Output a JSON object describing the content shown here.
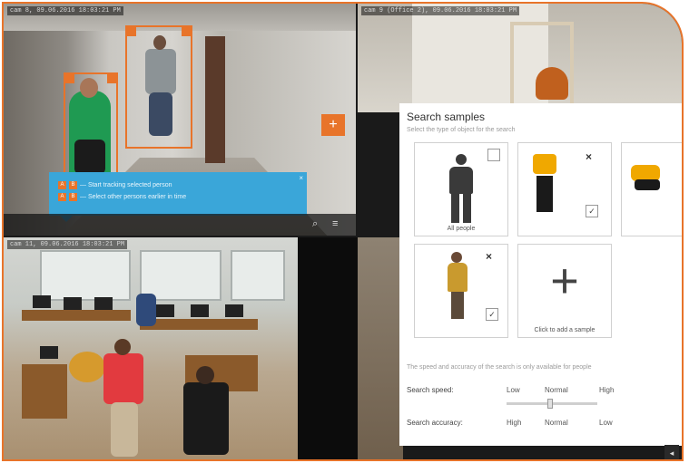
{
  "cameras": {
    "cam1_label": "cam 8, 09.06.2016 18:03:21 PM",
    "cam2_label": "cam 9 (Office 2), 09.06.2016 18:03:21 PM",
    "cam3_label": "cam 11, 09.06.2016 18:03:21 PM"
  },
  "tooltip": {
    "line1": "— Start tracking selected person",
    "line2": "— Select other persons earlier in time",
    "close": "×",
    "key_a": "A",
    "key_b": "B"
  },
  "search_panel": {
    "title": "Search samples",
    "subtitle": "Select the type of object for the search",
    "all_people_label": "All people",
    "add_sample_label": "Click to add a sample",
    "add_icon": "+",
    "remove_icon": "×",
    "check_mark": "✓",
    "note": "The speed and accuracy of the search is only available for people",
    "speed": {
      "label": "Search speed:",
      "options": [
        "Low",
        "Normal",
        "High"
      ],
      "value": "Normal"
    },
    "accuracy": {
      "label": "Search accuracy:",
      "options": [
        "High",
        "Normal",
        "Low"
      ]
    }
  },
  "icons": {
    "plus_button": "+",
    "search": "⌕",
    "menu": "≡",
    "next": "◂"
  },
  "colors": {
    "accent": "#e8742a",
    "tooltip": "#3aa6d9"
  }
}
